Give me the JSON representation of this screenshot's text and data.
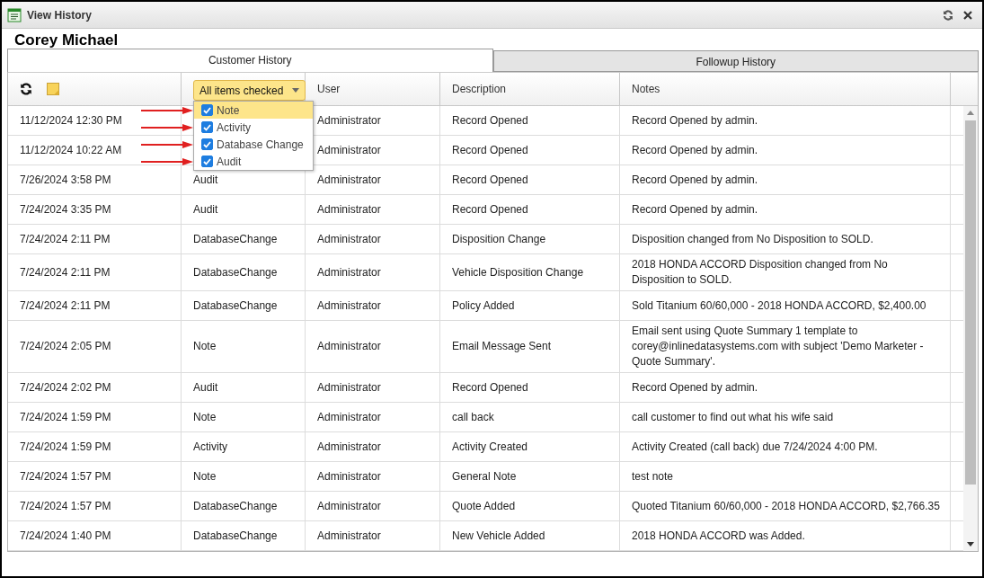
{
  "window": {
    "title": "View History"
  },
  "customer": "Corey Michael",
  "tabs": [
    {
      "label": "Customer History",
      "selected": true
    },
    {
      "label": "Followup History",
      "selected": false
    }
  ],
  "filter": {
    "label": "All items checked",
    "expanded": true,
    "options": [
      {
        "label": "Note",
        "checked": true,
        "selected": true,
        "arrow": true
      },
      {
        "label": "Activity",
        "checked": true,
        "selected": false,
        "arrow": true
      },
      {
        "label": "Database Change",
        "checked": true,
        "selected": false,
        "arrow": true
      },
      {
        "label": "Audit",
        "checked": true,
        "selected": false,
        "arrow": true
      }
    ]
  },
  "columns": [
    "User",
    "Description",
    "Notes"
  ],
  "rows": [
    {
      "date": "11/12/2024 12:30 PM",
      "type": "",
      "user": "Administrator",
      "description": "Record Opened",
      "notes": "Record Opened by admin."
    },
    {
      "date": "11/12/2024 10:22 AM",
      "type": "",
      "user": "Administrator",
      "description": "Record Opened",
      "notes": "Record Opened by admin."
    },
    {
      "date": "7/26/2024 3:58 PM",
      "type": "Audit",
      "user": "Administrator",
      "description": "Record Opened",
      "notes": "Record Opened by admin."
    },
    {
      "date": "7/24/2024 3:35 PM",
      "type": "Audit",
      "user": "Administrator",
      "description": "Record Opened",
      "notes": "Record Opened by admin."
    },
    {
      "date": "7/24/2024 2:11 PM",
      "type": "DatabaseChange",
      "user": "Administrator",
      "description": "Disposition Change",
      "notes": "Disposition changed from No Disposition to SOLD."
    },
    {
      "date": "7/24/2024 2:11 PM",
      "type": "DatabaseChange",
      "user": "Administrator",
      "description": "Vehicle Disposition Change",
      "notes": "2018 HONDA ACCORD Disposition changed from No Disposition to SOLD."
    },
    {
      "date": "7/24/2024 2:11 PM",
      "type": "DatabaseChange",
      "user": "Administrator",
      "description": "Policy Added",
      "notes": "Sold Titanium 60/60,000 - 2018 HONDA ACCORD, $2,400.00"
    },
    {
      "date": "7/24/2024 2:05 PM",
      "type": "Note",
      "user": "Administrator",
      "description": "Email Message Sent",
      "notes": "Email sent using Quote Summary 1 template to corey@inlinedatasystems.com with subject 'Demo Marketer - Quote Summary'."
    },
    {
      "date": "7/24/2024 2:02 PM",
      "type": "Audit",
      "user": "Administrator",
      "description": "Record Opened",
      "notes": "Record Opened by admin."
    },
    {
      "date": "7/24/2024 1:59 PM",
      "type": "Note",
      "user": "Administrator",
      "description": "call back",
      "notes": "call customer to find out what his wife said"
    },
    {
      "date": "7/24/2024 1:59 PM",
      "type": "Activity",
      "user": "Administrator",
      "description": "Activity Created",
      "notes": "Activity Created (call back) due 7/24/2024 4:00 PM."
    },
    {
      "date": "7/24/2024 1:57 PM",
      "type": "Note",
      "user": "Administrator",
      "description": "General Note",
      "notes": "test note"
    },
    {
      "date": "7/24/2024 1:57 PM",
      "type": "DatabaseChange",
      "user": "Administrator",
      "description": "Quote Added",
      "notes": "Quoted Titanium 60/60,000 - 2018 HONDA ACCORD, $2,766.35"
    },
    {
      "date": "7/24/2024 1:40 PM",
      "type": "DatabaseChange",
      "user": "Administrator",
      "description": "New Vehicle Added",
      "notes": "2018 HONDA ACCORD was Added."
    }
  ]
}
